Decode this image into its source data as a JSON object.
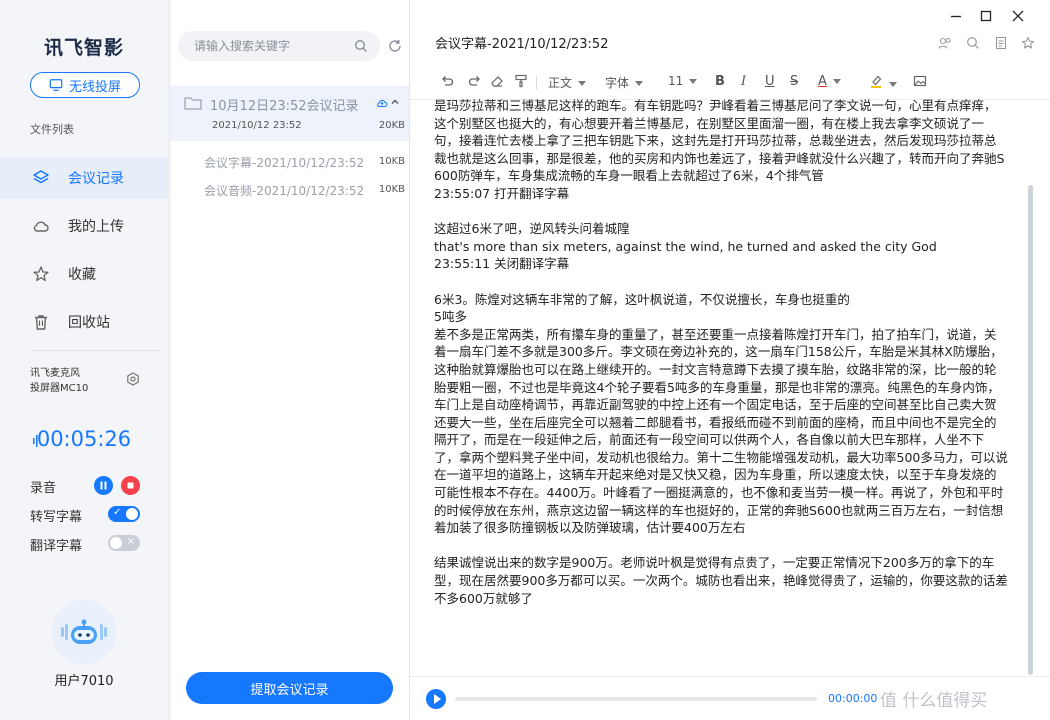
{
  "sidebar": {
    "logo": "讯飞智影",
    "cast_button": "无线投屏",
    "file_list_label": "文件列表",
    "nav": [
      {
        "label": "会议记录",
        "icon": "layers-icon",
        "active": true
      },
      {
        "label": "我的上传",
        "icon": "cloud-icon",
        "active": false
      },
      {
        "label": "收藏",
        "icon": "star-icon",
        "active": false
      },
      {
        "label": "回收站",
        "icon": "trash-icon",
        "active": false
      }
    ],
    "device_line1": "讯飞麦克风",
    "device_line2": "投屏器MC10",
    "timer": "00:05:26",
    "controls": {
      "record_label": "录音",
      "transcribe_label": "转写字幕",
      "transcribe_on": true,
      "translate_label": "翻译字幕",
      "translate_on": false
    },
    "username": "用户7010"
  },
  "files": {
    "search_placeholder": "请输入搜索关键字",
    "folder": {
      "title": "10月12日23:52会议记录",
      "date": "2021/10/12 23:52",
      "size": "20KB"
    },
    "items": [
      {
        "name": "会议字幕-2021/10/12/23:52",
        "size": "10KB"
      },
      {
        "name": "会议音频-2021/10/12/23:52",
        "size": "10KB"
      }
    ],
    "extract_button": "提取会议记录"
  },
  "editor": {
    "title": "会议字幕-2021/10/12/23:52",
    "toolbar": {
      "style_label": "正文",
      "font_label": "字体",
      "size_label": "11"
    },
    "paragraphs": [
      {
        "lines": [
          "是玛莎拉蒂和三博基尼这样的跑车。有车钥匙吗？尹峰看着三博基尼问了李文说一句，心里有点痒痒，",
          "这个别墅区也挺大的，有心想要开着兰博基尼，在别墅区里面溜一圈，有在楼上我去拿李文硕说了一",
          "句，接着连忙去楼上拿了三把车钥匙下来，这封先是打开玛莎拉蒂，总裁坐进去，然后发现玛莎拉蒂总",
          "裁也就是这么回事，那是很差，他的买房和内饰也差远了，接着尹峰就没什么兴趣了，转而开向了奔驰S",
          "600防弹车，车身集成流畅的车身一眼看上去就超过了6米，4个排气管",
          "23:55:07 打开翻译字幕"
        ]
      },
      {
        "lines": [
          "这超过6米了吧，逆风转头问着城隍",
          " that's more than six meters, against the wind, he turned and asked the city God",
          "23:55:11 关闭翻译字幕"
        ]
      },
      {
        "lines": [
          "6米3。陈煌对这辆车非常的了解，这叶枫说道，不仅说擅长，车身也挺重的",
          "5吨多",
          "差不多是正常两类，所有攥车身的重量了，甚至还要重一点接着陈煌打开车门，拍了拍车门，说道，关",
          "着一扇车门差不多就是300多斤。李文硕在旁边补充的，这一扇车门158公斤，车胎是米其林X防爆胎，",
          "这种胎就算爆胎也可以在路上继续开的。一封文言特意蹲下去摸了摸车胎，纹路非常的深，比一般的轮",
          "胎要粗一圈，不过也是毕竟这4个轮子要看5吨多的车身重量，那是也非常的漂亮。纯黑色的车身内饰，",
          "车门上是自动座椅调节，再靠近副驾驶的中控上还有一个固定电话，至于后座的空间甚至比自己卖大贺",
          "还要大一些，坐在后座完全可以翘着二郎腿看书，看报纸而碰不到前面的座椅，而且中间也不是完全的",
          "隔开了，而是在一段延伸之后，前面还有一段空间可以供两个人，各自像以前大巴车那样，人坐不下",
          "了，拿两个塑料凳子坐中间，发动机也很给力。第十二生物能增强发动机，最大功率500多马力，可以说",
          "在一道平坦的道路上，这辆车开起来绝对是又快又稳，因为车身重，所以速度太快，以至于车身发烧的",
          "可能性根本不存在。4400万。叶峰看了一圈挺满意的，也不像和麦当劳一模一样。再说了，外包和平时",
          "的时候停放在东州，燕京这边留一辆这样的车也挺好的，正常的奔驰S600也就两三百万左右，一封信想",
          "着加装了很多防撞钢板以及防弹玻璃，估计要400万左右"
        ]
      },
      {
        "lines": [
          "结果诚惶说出来的数字是900万。老师说叶枫是觉得有点贵了，一定要正常情况下200多万的拿下的车",
          "型，现在居然要900多万都可以买。一次两个。城防也看出来，艳峰觉得贵了，运输的，你要这款的话差",
          "不多600万就够了"
        ]
      }
    ],
    "player_time": "00:00:00",
    "watermark": "值 什么值得买"
  },
  "colors": {
    "accent": "#1677ff",
    "record_red": "#f5414b"
  }
}
